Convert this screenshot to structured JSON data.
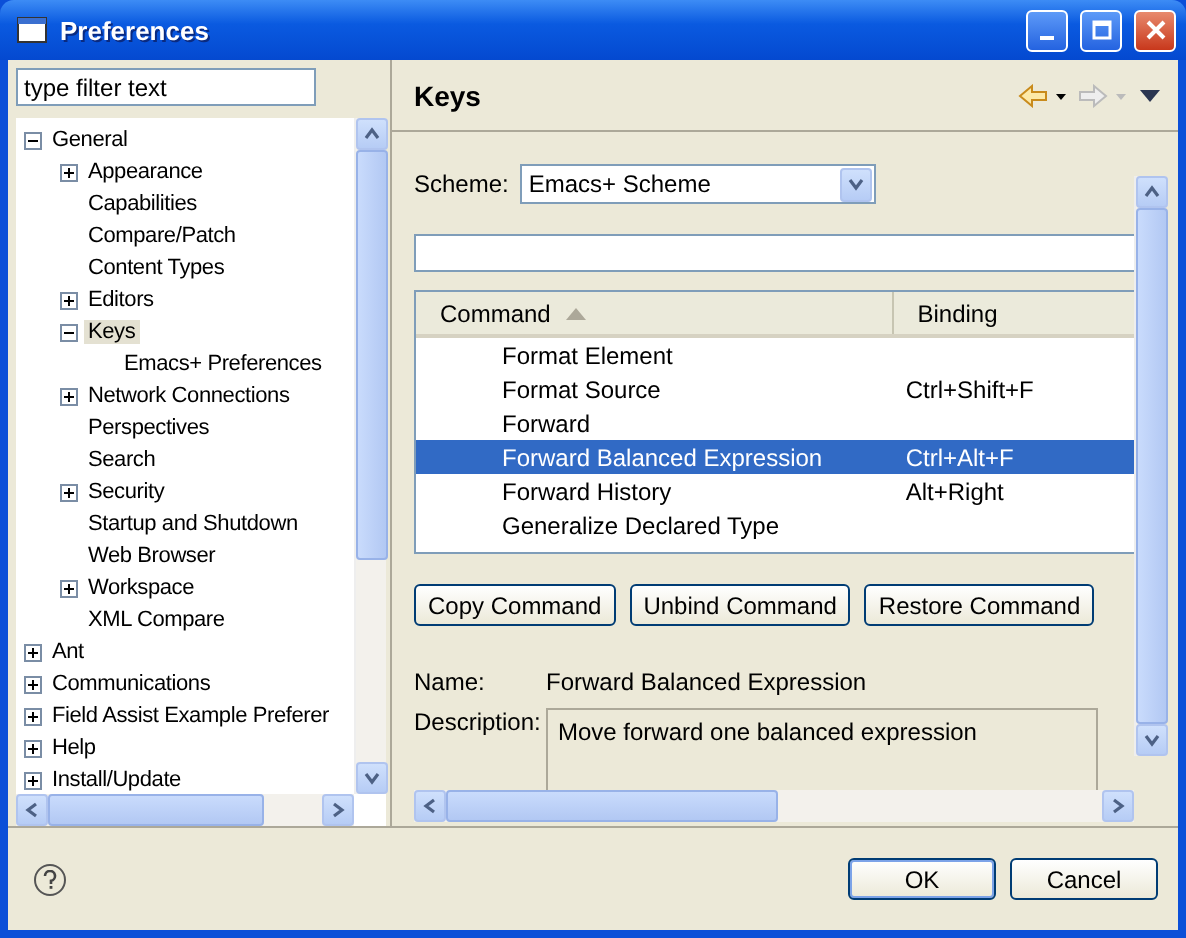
{
  "window": {
    "title": "Preferences"
  },
  "filter": {
    "placeholder": "type filter text"
  },
  "tree": [
    {
      "label": "General",
      "expanded": true,
      "selected": false,
      "children": [
        {
          "label": "Appearance",
          "expanded": false,
          "selected": false
        },
        {
          "label": "Capabilities",
          "selected": false
        },
        {
          "label": "Compare/Patch",
          "selected": false
        },
        {
          "label": "Content Types",
          "selected": false
        },
        {
          "label": "Editors",
          "expanded": false,
          "selected": false
        },
        {
          "label": "Keys",
          "expanded": true,
          "selected": true,
          "children": [
            {
              "label": "Emacs+ Preferences",
              "selected": false
            }
          ]
        },
        {
          "label": "Network Connections",
          "expanded": false,
          "selected": false
        },
        {
          "label": "Perspectives",
          "selected": false
        },
        {
          "label": "Search",
          "selected": false
        },
        {
          "label": "Security",
          "expanded": false,
          "selected": false
        },
        {
          "label": "Startup and Shutdown",
          "selected": false
        },
        {
          "label": "Web Browser",
          "selected": false
        },
        {
          "label": "Workspace",
          "expanded": false,
          "selected": false
        },
        {
          "label": "XML Compare",
          "selected": false
        }
      ]
    },
    {
      "label": "Ant",
      "expanded": false,
      "selected": false
    },
    {
      "label": "Communications",
      "expanded": false,
      "selected": false
    },
    {
      "label": "Field Assist Example Preferer",
      "expanded": false,
      "selected": false
    },
    {
      "label": "Help",
      "expanded": false,
      "selected": false
    },
    {
      "label": "Install/Update",
      "expanded": false,
      "selected": false
    }
  ],
  "page": {
    "title": "Keys"
  },
  "scheme": {
    "label": "Scheme:",
    "value": "Emacs+ Scheme"
  },
  "table": {
    "columns": [
      {
        "label": "Command",
        "sorted": true
      },
      {
        "label": "Binding",
        "sorted": false
      }
    ],
    "rows": [
      {
        "command": "Format Element",
        "binding": "",
        "selected": false
      },
      {
        "command": "Format Source",
        "binding": "Ctrl+Shift+F",
        "selected": false
      },
      {
        "command": "Forward",
        "binding": "",
        "selected": false
      },
      {
        "command": "Forward Balanced Expression",
        "binding": "Ctrl+Alt+F",
        "selected": true
      },
      {
        "command": "Forward History",
        "binding": "Alt+Right",
        "selected": false
      },
      {
        "command": "Generalize Declared Type",
        "binding": "",
        "selected": false
      }
    ]
  },
  "actions": [
    "Copy Command",
    "Unbind Command",
    "Restore Command"
  ],
  "details": {
    "name_label": "Name:",
    "name": "Forward Balanced Expression",
    "description_label": "Description:",
    "description": "Move forward one balanced expression"
  },
  "buttons": [
    {
      "label": "OK",
      "default": true
    },
    {
      "label": "Cancel",
      "default": false
    }
  ]
}
